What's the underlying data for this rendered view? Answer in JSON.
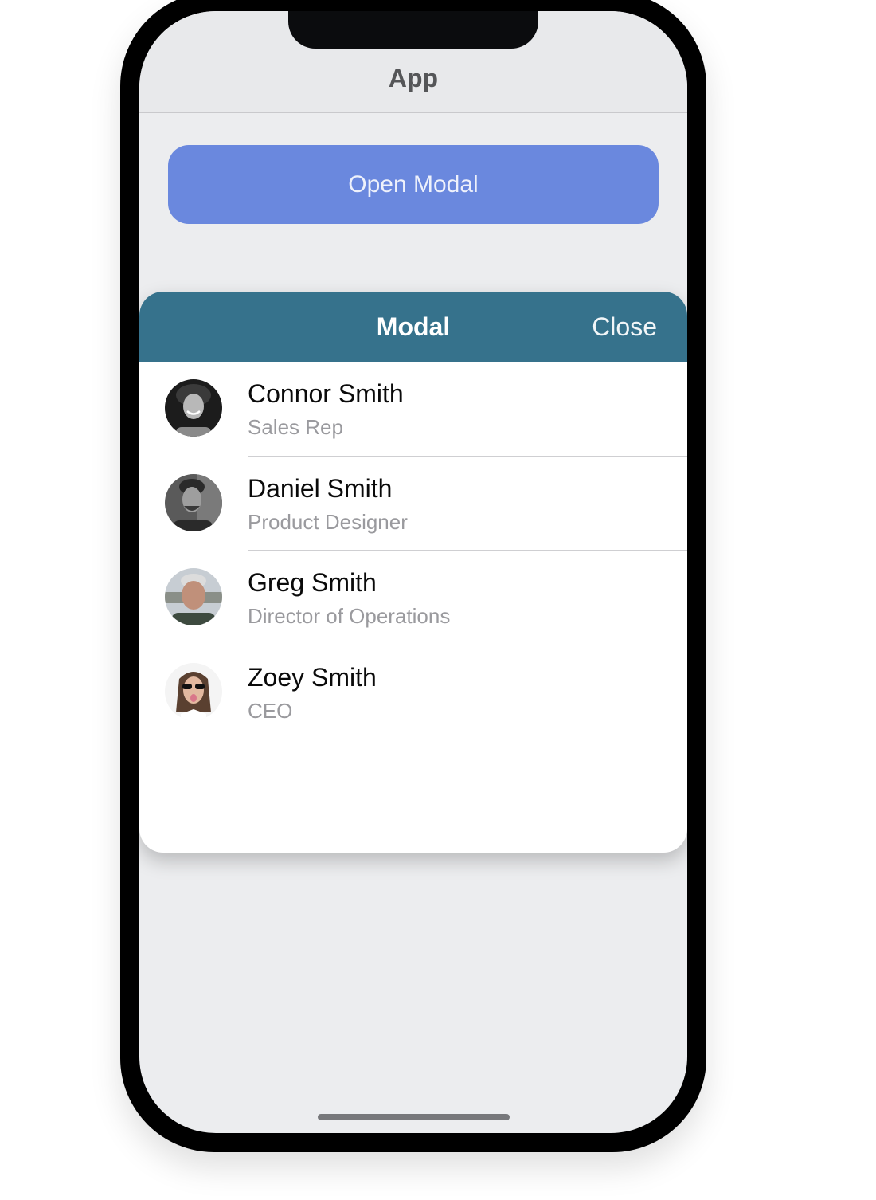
{
  "app": {
    "nav_title": "App",
    "open_modal_label": "Open Modal"
  },
  "modal": {
    "title": "Modal",
    "close_label": "Close",
    "items": [
      {
        "name": "Connor Smith",
        "role": "Sales Rep",
        "avatar": "connor-avatar"
      },
      {
        "name": "Daniel Smith",
        "role": "Product Designer",
        "avatar": "daniel-avatar"
      },
      {
        "name": "Greg Smith",
        "role": "Director of Operations",
        "avatar": "greg-avatar"
      },
      {
        "name": "Zoey Smith",
        "role": "CEO",
        "avatar": "zoey-avatar"
      }
    ]
  },
  "colors": {
    "button_bg": "#6a88de",
    "modal_header_bg": "#36728c",
    "screen_bg": "#ecedef",
    "nav_bg": "#e8e9eb"
  }
}
